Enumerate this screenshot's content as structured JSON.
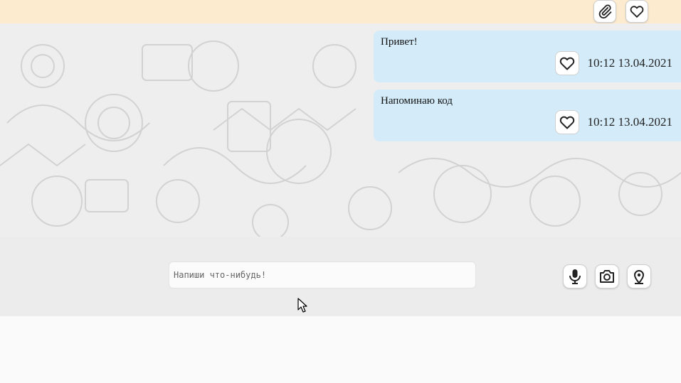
{
  "header": {
    "attach_icon": "paperclip-icon",
    "favorites_icon": "heart-icon"
  },
  "messages": [
    {
      "text": "Привет!",
      "time": "10:12 13.04.2021",
      "like_icon": "heart-icon"
    },
    {
      "text": "Напоминаю код",
      "time": "10:12 13.04.2021",
      "like_icon": "heart-icon"
    }
  ],
  "composer": {
    "placeholder": "Напиши что-нибудь!",
    "value": "",
    "tools": [
      "microphone-icon",
      "camera-icon",
      "location-pin-icon"
    ]
  },
  "colors": {
    "topbar": "#fdebd0",
    "bubble": "#d4ecfa",
    "composer": "#ececec"
  }
}
